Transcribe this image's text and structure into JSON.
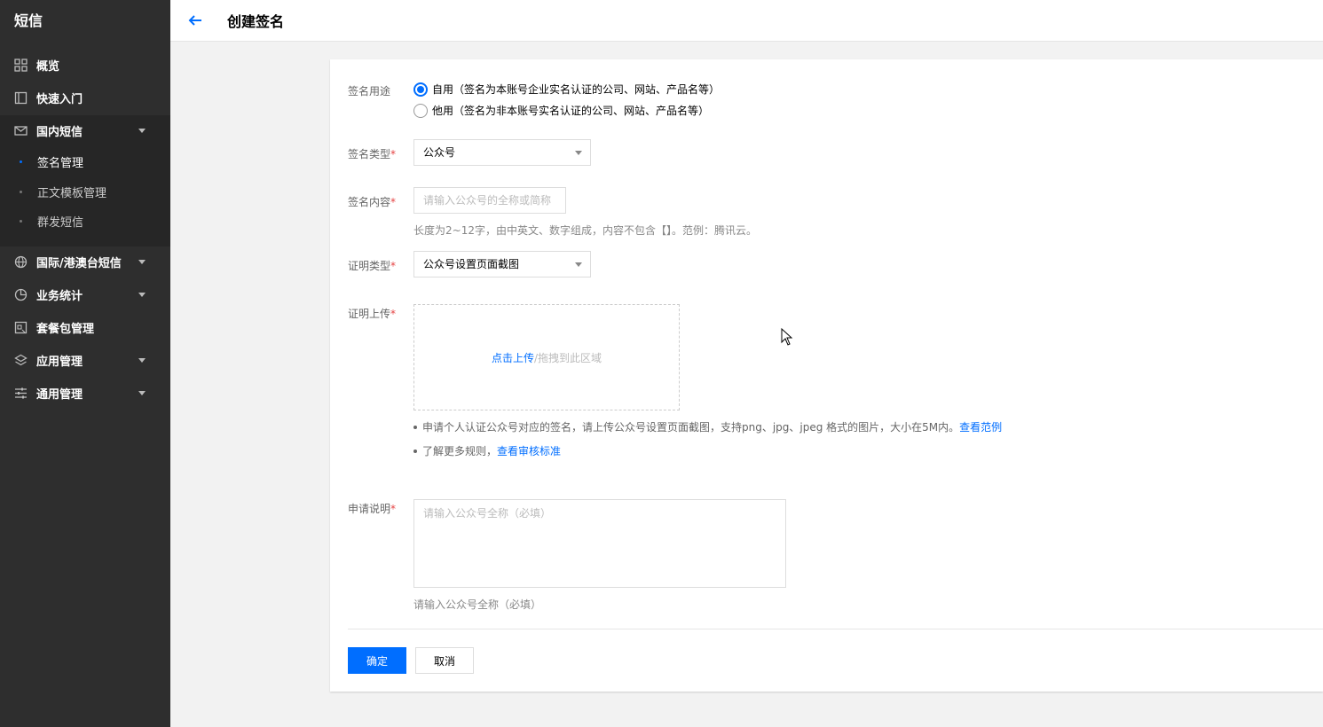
{
  "sidebar": {
    "title": "短信",
    "items": [
      {
        "label": "概览",
        "icon": "grid-icon"
      },
      {
        "label": "快速入门",
        "icon": "book-icon"
      },
      {
        "label": "国内短信",
        "icon": "mail-icon",
        "expanded": true
      },
      {
        "label": "国际/港澳台短信",
        "icon": "globe-icon"
      },
      {
        "label": "业务统计",
        "icon": "pie-chart-icon"
      },
      {
        "label": "套餐包管理",
        "icon": "package-icon"
      },
      {
        "label": "应用管理",
        "icon": "layers-icon"
      },
      {
        "label": "通用管理",
        "icon": "sliders-icon"
      }
    ],
    "sub_items": [
      {
        "label": "签名管理",
        "active": true
      },
      {
        "label": "正文模板管理",
        "active": false
      },
      {
        "label": "群发短信",
        "active": false
      }
    ]
  },
  "header": {
    "title": "创建签名"
  },
  "form": {
    "usage": {
      "label": "签名用途",
      "options": [
        {
          "label": "自用（签名为本账号企业实名认证的公司、网站、产品名等）",
          "checked": true
        },
        {
          "label": "他用（签名为非本账号实名认证的公司、网站、产品名等）",
          "checked": false
        }
      ]
    },
    "sign_type": {
      "label": "签名类型",
      "required_mark": "*",
      "value": "公众号"
    },
    "sign_content": {
      "label": "签名内容",
      "required_mark": "*",
      "placeholder": "请输入公众号的全称或简称",
      "help": "长度为2~12字，由中英文、数字组成，内容不包含【】。范例：腾讯云。"
    },
    "cert_type": {
      "label": "证明类型",
      "required_mark": "*",
      "value": "公众号设置页面截图"
    },
    "cert_upload": {
      "label": "证明上传",
      "required_mark": "*",
      "upload_link": "点击上传",
      "upload_text": "/拖拽到此区域",
      "note1": "申请个人认证公众号对应的签名，请上传公众号设置页面截图，支持png、jpg、jpeg 格式的图片，大小在5M内。",
      "note1_link": "查看范例",
      "note2": "了解更多规则，",
      "note2_link": "查看审核标准"
    },
    "application_note": {
      "label": "申请说明",
      "required_mark": "*",
      "placeholder": "请输入公众号全称（必填）",
      "help": "请输入公众号全称（必填）"
    },
    "buttons": {
      "confirm": "确定",
      "cancel": "取消"
    }
  },
  "colors": {
    "accent": "#006eff",
    "sidebar_bg": "#2e2e2e",
    "required": "#e54545"
  }
}
